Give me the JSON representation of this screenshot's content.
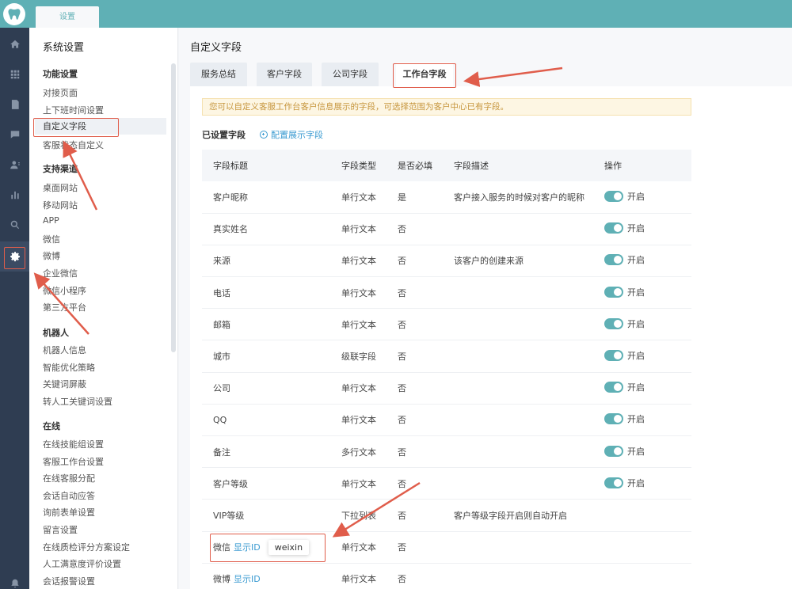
{
  "top_tab": "设置",
  "logo_icon": "tooth-icon",
  "rail": [
    "home-icon",
    "grid-icon",
    "document-icon",
    "chat-icon",
    "contacts-icon",
    "chart-icon",
    "search-icon",
    "gear-icon",
    "bell-icon"
  ],
  "sidebar": {
    "title": "系统设置",
    "groups": [
      {
        "label": "功能设置",
        "items": [
          "对接页面",
          "上下班时间设置",
          "自定义字段",
          "客服状态自定义"
        ]
      },
      {
        "label": "支持渠道",
        "items": [
          "桌面网站",
          "移动网站",
          "APP",
          "微信",
          "微博",
          "企业微信",
          "微信小程序",
          "第三方平台"
        ]
      },
      {
        "label": "机器人",
        "items": [
          "机器人信息",
          "智能优化策略",
          "关键词屏蔽",
          "转人工关键词设置"
        ]
      },
      {
        "label": "在线",
        "items": [
          "在线技能组设置",
          "客服工作台设置",
          "在线客服分配",
          "会话自动应答",
          "询前表单设置",
          "留言设置",
          "在线质检评分方案设定",
          "人工满意度评价设置",
          "会话报警设置"
        ]
      }
    ]
  },
  "main": {
    "title": "自定义字段",
    "tabs": [
      "服务总结",
      "客户字段",
      "公司字段",
      "工作台字段"
    ],
    "notice": "您可以自定义客服工作台客户信息展示的字段，可选择范围为客户中心已有字段。",
    "set_label": "已设置字段",
    "config_link": "配置展示字段",
    "columns": [
      "字段标题",
      "字段类型",
      "是否必填",
      "字段描述",
      "操作"
    ],
    "toggle_label": "开启",
    "show_id_label": "显示ID",
    "rows": [
      {
        "title": "客户昵称",
        "type": "单行文本",
        "required": "是",
        "desc": "客户接入服务的时候对客户的昵称",
        "toggle": true
      },
      {
        "title": "真实姓名",
        "type": "单行文本",
        "required": "否",
        "desc": "",
        "toggle": true
      },
      {
        "title": "来源",
        "type": "单行文本",
        "required": "否",
        "desc": "该客户的创建来源",
        "toggle": true
      },
      {
        "title": "电话",
        "type": "单行文本",
        "required": "否",
        "desc": "",
        "toggle": true
      },
      {
        "title": "邮箱",
        "type": "单行文本",
        "required": "否",
        "desc": "",
        "toggle": true
      },
      {
        "title": "城市",
        "type": "级联字段",
        "required": "否",
        "desc": "",
        "toggle": true
      },
      {
        "title": "公司",
        "type": "单行文本",
        "required": "否",
        "desc": "",
        "toggle": true
      },
      {
        "title": "QQ",
        "type": "单行文本",
        "required": "否",
        "desc": "",
        "toggle": true
      },
      {
        "title": "备注",
        "type": "多行文本",
        "required": "否",
        "desc": "",
        "toggle": true
      },
      {
        "title": "客户等级",
        "type": "单行文本",
        "required": "否",
        "desc": "",
        "toggle": true
      },
      {
        "title": "VIP等级",
        "type": "下拉列表",
        "required": "否",
        "desc": "客户等级字段开启则自动开启",
        "toggle": false
      },
      {
        "title": "微信",
        "type": "单行文本",
        "required": "否",
        "desc": "",
        "toggle": false,
        "show_id": true,
        "tooltip": "weixin"
      },
      {
        "title": "微博",
        "type": "单行文本",
        "required": "否",
        "desc": "",
        "toggle": false,
        "show_id": true
      }
    ]
  },
  "colors": {
    "accent": "#5fb0b5",
    "rail_bg": "#2f3d52",
    "link": "#3b9bd1",
    "annotation": "#e05d4b"
  }
}
